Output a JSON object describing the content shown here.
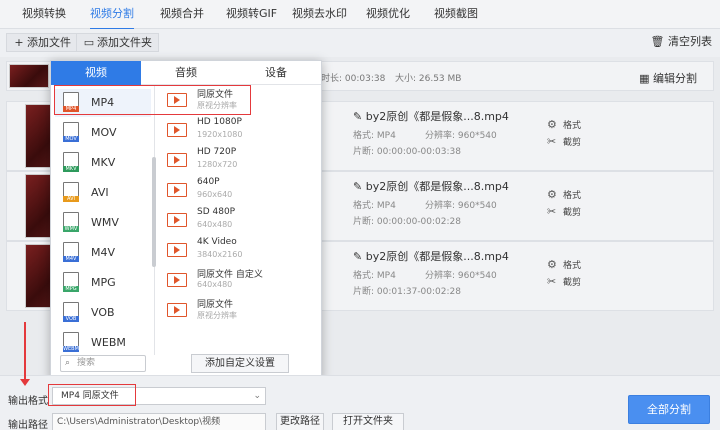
{
  "top_tabs": [
    "视频转换",
    "视频分割",
    "视频合并",
    "视频转GIF",
    "视频去水印",
    "视频优化",
    "视频截图"
  ],
  "active_tab": "视频分割",
  "toolbar": {
    "add_file": "添加文件",
    "add_folder": "添加文件夹",
    "clear_list": "清空列表"
  },
  "header_row": {
    "duration": "时长: 00:03:38",
    "size": "大小: 26.53 MB",
    "edit_split": "编辑分割"
  },
  "files": [
    {
      "name": "by2原创《都是假象...8.mp4",
      "format": "格式:  MP4",
      "resolution": "分辨率: 960*540",
      "segment": "片断:  00:00:00-00:03:38",
      "settings": "格式",
      "cut": "截剪"
    },
    {
      "name": "by2原创《都是假象...8.mp4",
      "format": "格式:  MP4",
      "resolution": "分辨率: 960*540",
      "segment": "片断:  00:00:00-00:02:28",
      "settings": "格式",
      "cut": "截剪"
    },
    {
      "name": "by2原创《都是假象...8.mp4",
      "format": "格式:  MP4",
      "resolution": "分辨率: 960*540",
      "segment": "片断:  00:01:37-00:02:28",
      "settings": "格式",
      "cut": "截剪"
    }
  ],
  "popup": {
    "tabs": [
      "视频",
      "音频",
      "设备"
    ],
    "active_tab": "视频",
    "formats": [
      {
        "label": "MP4",
        "color": "#e0552a"
      },
      {
        "label": "MOV",
        "color": "#3a6fd6"
      },
      {
        "label": "MKV",
        "color": "#2e9a5c"
      },
      {
        "label": "AVI",
        "color": "#e89a1c"
      },
      {
        "label": "WMV",
        "color": "#3aa66a"
      },
      {
        "label": "M4V",
        "color": "#3a6fd6"
      },
      {
        "label": "MPG",
        "color": "#3aa66a"
      },
      {
        "label": "VOB",
        "color": "#3a6fd6"
      },
      {
        "label": "WEBM",
        "color": "#3a6fd6"
      }
    ],
    "selected_format": "MP4",
    "presets": [
      {
        "title": "同原文件",
        "sub": "原视分辨率"
      },
      {
        "title": "HD 1080P",
        "sub": "1920x1080"
      },
      {
        "title": "HD 720P",
        "sub": "1280x720"
      },
      {
        "title": "640P",
        "sub": "960x640"
      },
      {
        "title": "SD 480P",
        "sub": "640x480"
      },
      {
        "title": "4K Video",
        "sub": "3840x2160"
      },
      {
        "title": "同原文件 自定义",
        "sub": "640x480"
      },
      {
        "title": "同原文件",
        "sub": "原视分辨率"
      }
    ],
    "search_placeholder": "搜索",
    "customize": "添加自定义设置"
  },
  "bottom": {
    "output_format_label": "输出格式",
    "output_format_value": "MP4  同原文件",
    "output_path_label": "输出路径",
    "output_path_value": "C:\\Users\\Administrator\\Desktop\\视频",
    "change_path": "更改路径",
    "open_folder": "打开文件夹",
    "split_all": "全部分割"
  },
  "colors": {
    "accent": "#2f7be6",
    "annotation_red": "#e4393c"
  }
}
